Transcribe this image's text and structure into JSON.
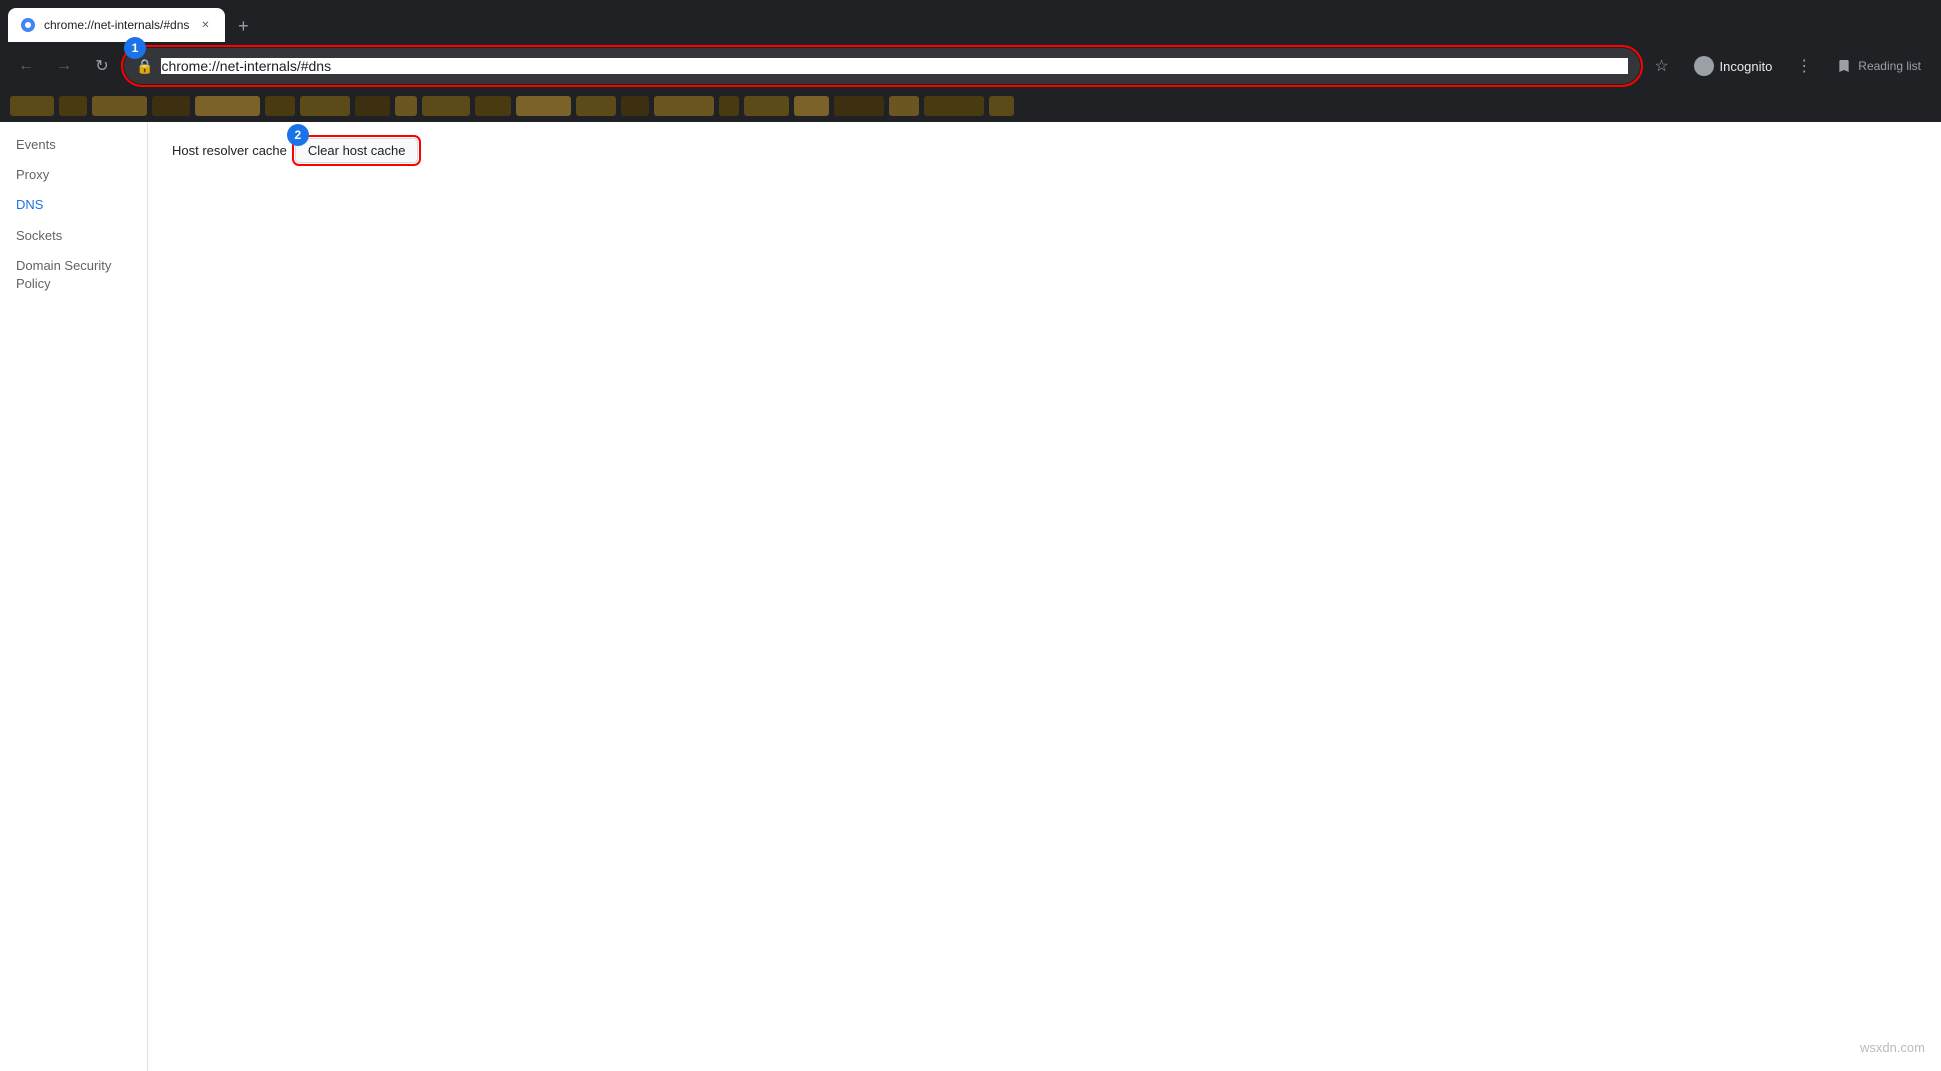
{
  "browser": {
    "tab": {
      "favicon": "⬛",
      "title": "chrome://net-internals/#dns",
      "close_icon": "✕"
    },
    "new_tab_icon": "+",
    "toolbar": {
      "back_icon": "←",
      "forward_icon": "→",
      "reload_icon": "↻",
      "address": "chrome://net-internals/#dns",
      "lock_icon": "🔒",
      "star_icon": "☆",
      "incognito_label": "Incognito",
      "menu_icon": "⋮",
      "reading_list_label": "Reading list"
    },
    "annotations": {
      "badge1": "1",
      "badge2": "2"
    }
  },
  "sidebar": {
    "items": [
      {
        "label": "Events",
        "active": false
      },
      {
        "label": "Proxy",
        "active": false
      },
      {
        "label": "DNS",
        "active": true
      },
      {
        "label": "Sockets",
        "active": false
      },
      {
        "label": "Domain Security Policy",
        "active": false
      }
    ]
  },
  "main": {
    "dns_label": "Host resolver cache",
    "clear_cache_button": "Clear host cache"
  },
  "watermark": {
    "text": "wsxdn.com"
  }
}
